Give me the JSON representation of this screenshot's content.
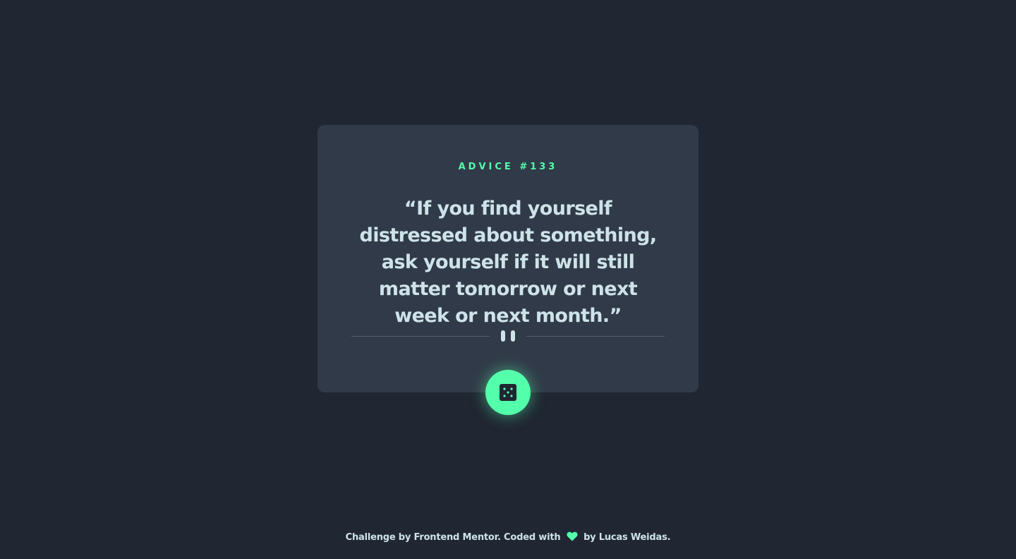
{
  "advice": {
    "label": "ADVICE",
    "number": "#133",
    "quote": "“If you find yourself distressed about something, ask yourself if it will still matter tomorrow or next week or next month.”"
  },
  "divider": {
    "icon": "pause-icon"
  },
  "button": {
    "icon": "dice-icon"
  },
  "footer": {
    "text_before": "Challenge by Frontend Mentor. Coded with",
    "heart_icon": "heart-icon",
    "text_after": "by Lucas Weidas."
  },
  "colors": {
    "background": "#202632",
    "card": "#313a48",
    "accent": "#53ffaa",
    "text": "#cee3e9",
    "divider": "#4f5d74"
  }
}
